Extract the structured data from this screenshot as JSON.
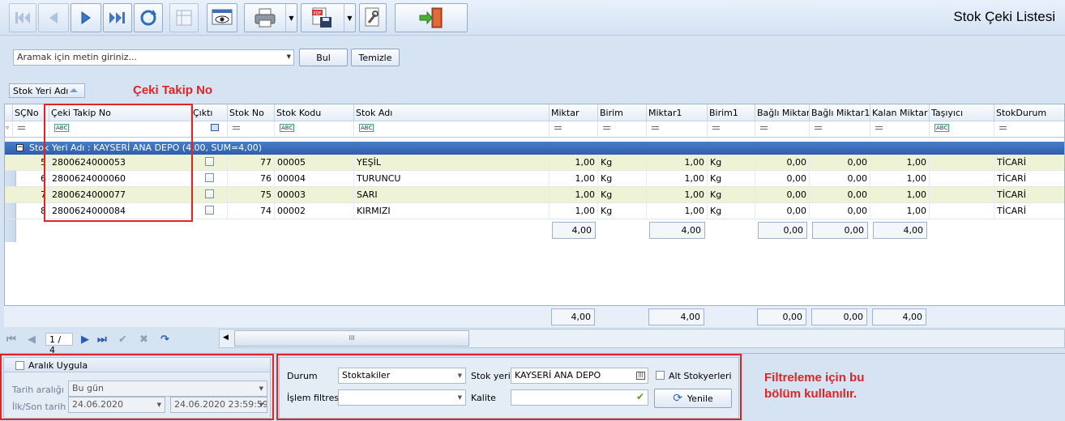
{
  "title": "Stok Çeki Listesi",
  "toolbar": {
    "buttons": [
      "first-record",
      "previous-record",
      "next-record",
      "last-record",
      "refresh",
      "grid-settings",
      "preview",
      "print",
      "pdf-save",
      "tools",
      "exit"
    ]
  },
  "search": {
    "placeholder": "Aramak için metin giriniz...",
    "find_label": "Bul",
    "clear_label": "Temizle"
  },
  "group_chip": "Stok Yeri Adı",
  "annotations": {
    "column_note": "Çeki Takip No",
    "filter_note_line1": "Filtreleme için bu",
    "filter_note_line2": "bölüm kullanılır."
  },
  "grid": {
    "columns": [
      "SÇNo",
      "Çeki Takip No",
      "Çıktı",
      "Stok No",
      "Stok Kodu",
      "Stok Adı",
      "Miktar",
      "Birim",
      "Miktar1",
      "Birim1",
      "Bağlı Miktar",
      "Bağlı Miktar1",
      "Kalan Miktar1",
      "Taşıyıcı",
      "StokDurum"
    ],
    "group_row": "Stok Yeri Adı : KAYSERİ ANA DEPO (4,00, SUM=4,00)",
    "rows": [
      {
        "sc": "5",
        "takip": "2800624000053",
        "cikti": false,
        "stokno": "77",
        "kod": "00005",
        "ad": "YEŞİL",
        "miktar": "1,00",
        "birim": "Kg",
        "miktar1": "1,00",
        "birim1": "Kg",
        "bagli": "0,00",
        "bagli1": "0,00",
        "kalan1": "1,00",
        "tasiyici": "",
        "durum": "TİCARİ"
      },
      {
        "sc": "6",
        "takip": "2800624000060",
        "cikti": false,
        "stokno": "76",
        "kod": "00004",
        "ad": "TURUNCU",
        "miktar": "1,00",
        "birim": "Kg",
        "miktar1": "1,00",
        "birim1": "Kg",
        "bagli": "0,00",
        "bagli1": "0,00",
        "kalan1": "1,00",
        "tasiyici": "",
        "durum": "TİCARİ"
      },
      {
        "sc": "7",
        "takip": "2800624000077",
        "cikti": false,
        "stokno": "75",
        "kod": "00003",
        "ad": "SARI",
        "miktar": "1,00",
        "birim": "Kg",
        "miktar1": "1,00",
        "birim1": "Kg",
        "bagli": "0,00",
        "bagli1": "0,00",
        "kalan1": "1,00",
        "tasiyici": "",
        "durum": "TİCARİ"
      },
      {
        "sc": "8",
        "takip": "2800624000084",
        "cikti": false,
        "stokno": "74",
        "kod": "00002",
        "ad": "KIRMIZI",
        "miktar": "1,00",
        "birim": "Kg",
        "miktar1": "1,00",
        "birim1": "Kg",
        "bagli": "0,00",
        "bagli1": "0,00",
        "kalan1": "1,00",
        "tasiyici": "",
        "durum": "TİCARİ"
      }
    ],
    "group_sums": {
      "miktar": "4,00",
      "miktar1": "4,00",
      "bagli": "0,00",
      "bagli1": "0,00",
      "kalan1": "4,00"
    },
    "footer_sums": {
      "miktar": "4,00",
      "miktar1": "4,00",
      "bagli": "0,00",
      "bagli1": "0,00",
      "kalan1": "4,00"
    }
  },
  "navigator": {
    "page": "1 / 4",
    "thumb_grip": "III"
  },
  "date_panel": {
    "checkbox_label": "Aralık Uygula",
    "range_label": "Tarih aralığı",
    "range_value": "Bu gün",
    "first_last_label": "İlk/Son tarih",
    "start_date": "24.06.2020",
    "end_date": "24.06.2020 23:59:59"
  },
  "filter_panel": {
    "status_label": "Durum",
    "status_value": "Stoktakiler",
    "process_label": "İşlem filtresi",
    "process_value": "",
    "location_label": "Stok yeri",
    "location_value": "KAYSERİ ANA DEPO",
    "quality_label": "Kalite",
    "quality_value": "",
    "sub_locations_label": "Alt Stokyerleri",
    "refresh_label": "Yenile"
  },
  "colors": {
    "group_row": "#2b5fae",
    "accent_red": "#e02424",
    "alt_row": "#eef3d6"
  }
}
